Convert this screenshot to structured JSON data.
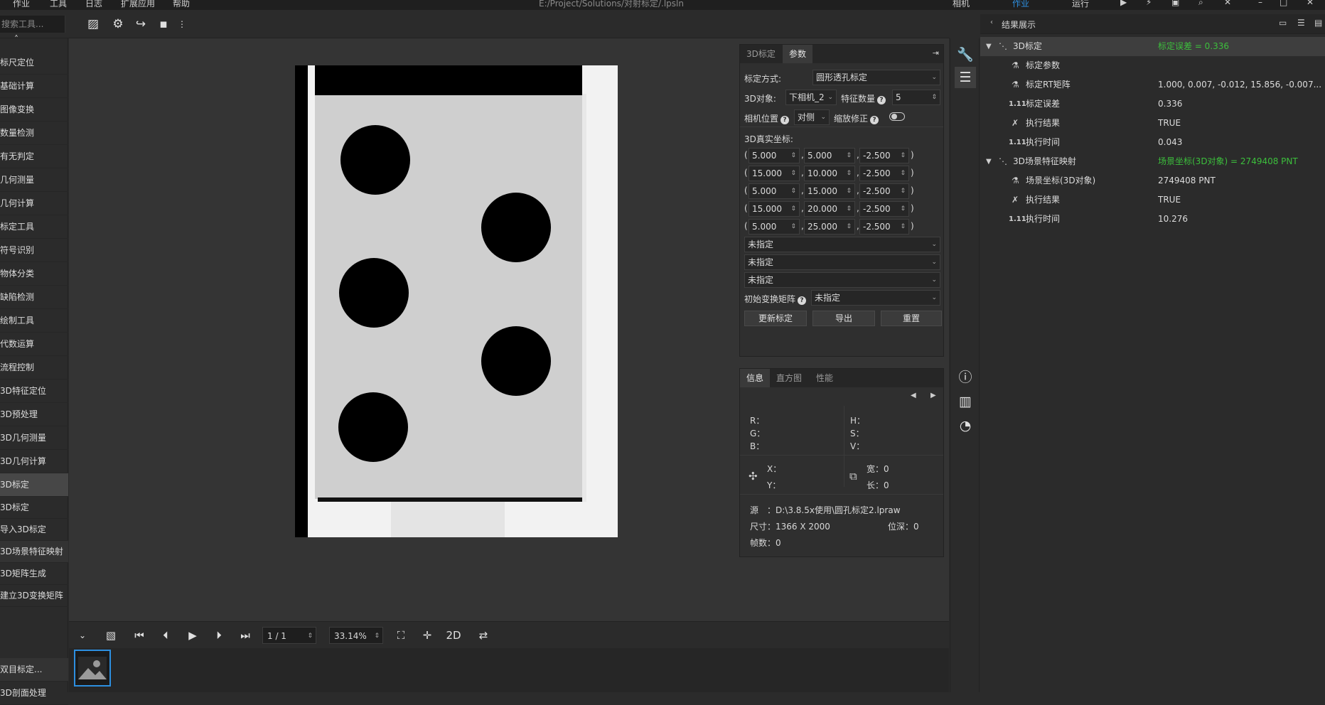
{
  "menubar": {
    "items": [
      "作业",
      "工具",
      "日志",
      "扩展应用",
      "帮助"
    ],
    "title": "E:/Project/Solutions/对射标定/.lpsln",
    "right_items": [
      "相机",
      "作业",
      "运行"
    ]
  },
  "toolbar": {
    "search_placeholder": "搜索工具..."
  },
  "left_panel": {
    "items": [
      "标尺定位",
      "基础计算",
      "图像变换",
      "数量检测",
      "有无判定",
      "几何测量",
      "几何计算",
      "标定工具",
      "符号识别",
      "物体分类",
      "缺陷检测",
      "绘制工具",
      "代数运算",
      "流程控制",
      "3D特征定位",
      "3D预处理",
      "3D几何测量",
      "3D几何计算",
      "3D标定",
      "3D标定",
      "导入3D标定",
      "3D场景特征映射",
      "3D矩阵生成",
      "建立3D变换矩阵",
      "双目标定...",
      "3D剖面处理"
    ]
  },
  "params": {
    "tabs": [
      "3D标定",
      "参数"
    ],
    "method_label": "标定方式:",
    "method_value": "圆形透孔标定",
    "object_label": "3D对象:",
    "object_value": "下相机_2",
    "feature_count_label": "特征数量",
    "feature_count_value": "5",
    "camera_pos_label": "相机位置",
    "camera_pos_value": "对侧",
    "scale_fix_label": "缩放修正",
    "real_coords_label": "3D真实坐标:",
    "coords": [
      [
        "5.000",
        "5.000",
        "-2.500"
      ],
      [
        "15.000",
        "10.000",
        "-2.500"
      ],
      [
        "5.000",
        "15.000",
        "-2.500"
      ],
      [
        "15.000",
        "20.000",
        "-2.500"
      ],
      [
        "5.000",
        "25.000",
        "-2.500"
      ]
    ],
    "unspecified": [
      "未指定",
      "未指定",
      "未指定"
    ],
    "init_matrix_label": "初始变换矩阵",
    "init_matrix_value": "未指定",
    "buttons": [
      "更新标定",
      "导出",
      "重置"
    ]
  },
  "info": {
    "tabs": [
      "信息",
      "直方图",
      "性能"
    ],
    "r": "R：",
    "g": "G：",
    "b": "B：",
    "h": "H：",
    "s": "S：",
    "v": "V：",
    "x": "X：",
    "y": "Y：",
    "width": "宽：0",
    "length": "长：0",
    "source": "源　：D:\\3.8.5x使用\\圆孔标定2.lpraw",
    "size": "尺寸：1366 X 2000",
    "depth": "位深：0",
    "frames": "帧数：0"
  },
  "playbar": {
    "frame": "1 / 1",
    "zoom": "33.14%",
    "mode": "2D"
  },
  "results": {
    "title": "结果展示",
    "rows": [
      {
        "name": "3D标定",
        "value": "标定误差 = 0.336",
        "green": true
      },
      {
        "name": "标定参数",
        "value": ""
      },
      {
        "name": "标定RT矩阵",
        "value": "1.000, 0.007, -0.012, 15.856, -0.007..."
      },
      {
        "name": "标定误差",
        "value": "0.336"
      },
      {
        "name": "执行结果",
        "value": "TRUE"
      },
      {
        "name": "执行时间",
        "value": "0.043"
      },
      {
        "name": "3D场景特征映射",
        "value": "场景坐标(3D对象) = 2749408 PNT",
        "green": true
      },
      {
        "name": "场景坐标(3D对象)",
        "value": "2749408 PNT"
      },
      {
        "name": "执行结果",
        "value": "TRUE"
      },
      {
        "name": "执行时间",
        "value": "10.276"
      }
    ]
  },
  "colors": {
    "accent": "#2d8fe0",
    "green": "#3cbf3c"
  }
}
